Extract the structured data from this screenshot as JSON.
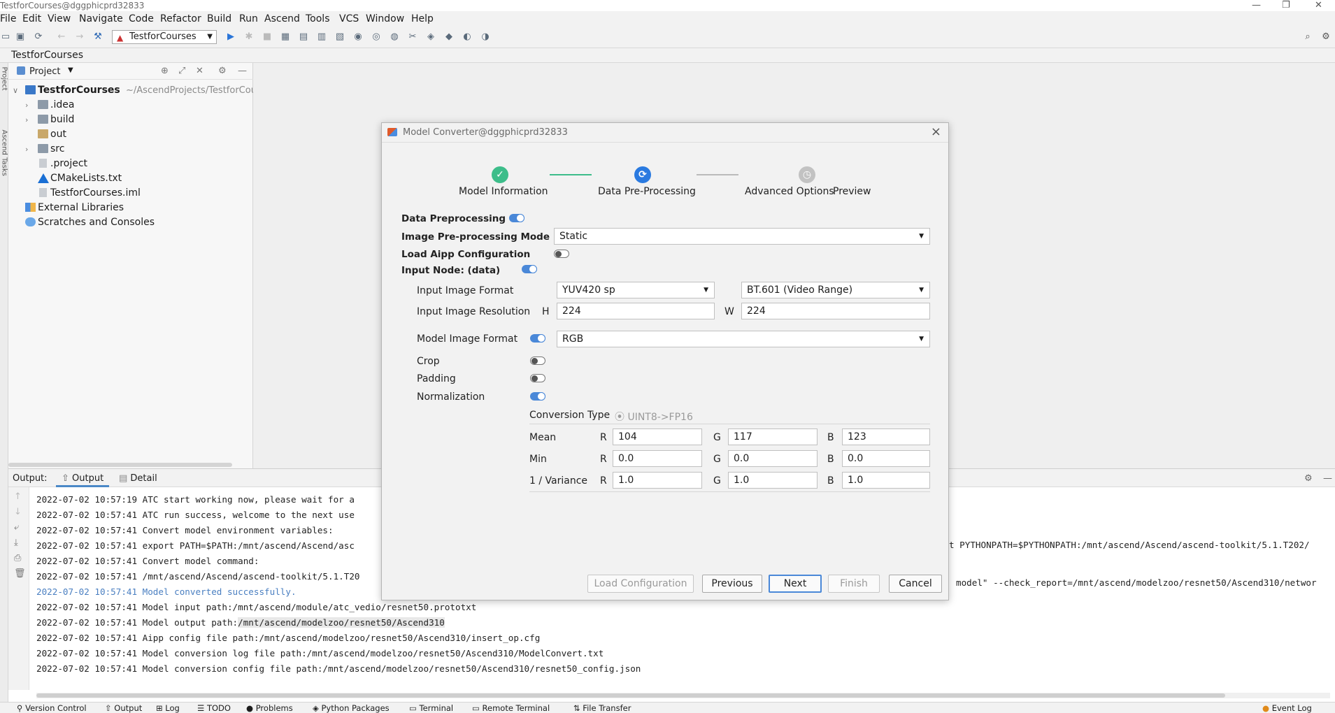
{
  "window": {
    "title": "TestforCourses@dggphicprd32833"
  },
  "menu": [
    "File",
    "Edit",
    "View",
    "Navigate",
    "Code",
    "Refactor",
    "Build",
    "Run",
    "Ascend",
    "Tools",
    "VCS",
    "Window",
    "Help"
  ],
  "toolbar": {
    "run_config": "TestforCourses"
  },
  "breadcrumb": "TestforCourses",
  "project_panel": {
    "title": "Project",
    "root": "TestforCourses",
    "root_path": "~/AscendProjects/TestforCou",
    "items": [
      ".idea",
      "build",
      "out",
      "src",
      ".project",
      "CMakeLists.txt",
      "TestforCourses.iml"
    ],
    "external": "External Libraries",
    "scratches": "Scratches and Consoles"
  },
  "output": {
    "label": "Output:",
    "tabs": [
      "Output",
      "Detail"
    ],
    "lines": [
      "2022-07-02 10:57:19  ATC start working now, please wait for a",
      "2022-07-02 10:57:41  ATC run success, welcome to the next use",
      "2022-07-02 10:57:41  Convert model environment variables:",
      "2022-07-02 10:57:41  export PATH=$PATH:/mnt/ascend/Ascend/asc",
      "2022-07-02 10:57:41  Convert model command:",
      "2022-07-02 10:57:41  /mnt/ascend/Ascend/ascend-toolkit/5.1.T20",
      "2022-07-02 10:57:41  Model converted successfully.",
      "2022-07-02 10:57:41  Model input path:/mnt/ascend/module/atc_vedio/resnet50.prototxt",
      "2022-07-02 10:57:41  Model output path:/mnt/ascend/modelzoo/resnet50/Ascend310",
      "2022-07-02 10:57:41  Aipp config file path:/mnt/ascend/modelzoo/resnet50/Ascend310/insert_op.cfg",
      "2022-07-02 10:57:41  Model conversion log file path:/mnt/ascend/modelzoo/resnet50/Ascend310/ModelConvert.txt",
      "2022-07-02 10:57:41  Model conversion config file path:/mnt/ascend/modelzoo/resnet50/Ascend310/resnet50_config.json"
    ],
    "right_frag_1": "t PYTHONPATH=$PYTHONPATH:/mnt/ascend/Ascend/ascend-toolkit/5.1.T202/",
    "right_frag_2": "model\" --check_report=/mnt/ascend/modelzoo/resnet50/Ascend310/networ"
  },
  "statusbar": [
    "Version Control",
    "Output",
    "Log",
    "TODO",
    "Problems",
    "Python Packages",
    "Terminal",
    "Remote Terminal",
    "File Transfer",
    "Event Log"
  ],
  "dialog": {
    "title": "Model Converter@dggphicprd32833",
    "steps": [
      "Model Information",
      "Data Pre-Processing",
      "Advanced Options",
      "Preview"
    ],
    "data_preprocessing": "Data Preprocessing",
    "mode_label": "Image Pre-processing Mode",
    "mode_value": "Static",
    "load_aipp": "Load Aipp Configuration",
    "input_node": "Input Node:  (data)",
    "input_format_label": "Input Image Format",
    "input_format_value": "YUV420 sp",
    "color_space": "BT.601 (Video Range)",
    "resolution_label": "Input Image Resolution",
    "h_label": "H",
    "h_value": "224",
    "w_label": "W",
    "w_value": "224",
    "model_format_label": "Model Image Format",
    "model_format_value": "RGB",
    "crop": "Crop",
    "padding": "Padding",
    "normalization": "Normalization",
    "conversion_type_label": "Conversion Type",
    "conversion_type_value": "UINT8->FP16",
    "rows": [
      {
        "label": "Mean",
        "r": "104",
        "g": "117",
        "b": "123"
      },
      {
        "label": "Min",
        "r": "0.0",
        "g": "0.0",
        "b": "0.0"
      },
      {
        "label": "1 / Variance",
        "r": "1.0",
        "g": "1.0",
        "b": "1.0"
      }
    ],
    "ch_r": "R",
    "ch_g": "G",
    "ch_b": "B",
    "buttons": {
      "load": "Load Configuration",
      "previous": "Previous",
      "next": "Next",
      "finish": "Finish",
      "cancel": "Cancel"
    }
  }
}
